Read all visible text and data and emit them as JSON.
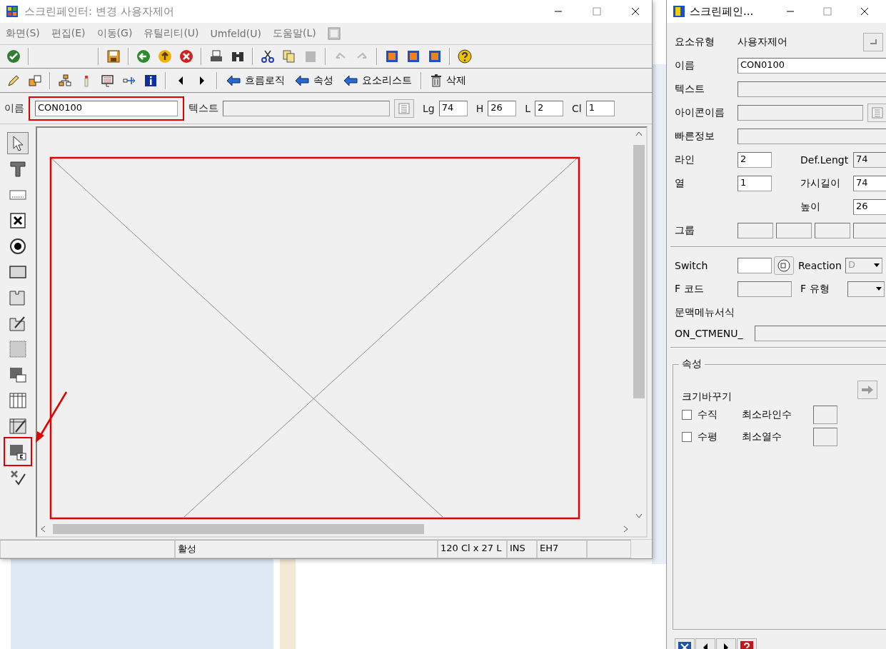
{
  "main_window": {
    "title": "스크린페인터:  변경 사용자제어"
  },
  "menu": [
    {
      "label": "화면(S)"
    },
    {
      "label": "편집(E)"
    },
    {
      "label": "이동(G)"
    },
    {
      "label": "유틸리티(U)"
    },
    {
      "label": "Umfeld(U)"
    },
    {
      "label": "도움말(L)"
    }
  ],
  "toolbar_1": [
    {
      "kind": "check",
      "disabled": false
    },
    {
      "kind": "separator"
    },
    {
      "kind": "spacer"
    },
    {
      "kind": "separator"
    },
    {
      "kind": "save",
      "disabled": false
    },
    {
      "kind": "separator"
    },
    {
      "kind": "back",
      "disabled": false
    },
    {
      "kind": "exit",
      "disabled": false
    },
    {
      "kind": "cancel",
      "disabled": false
    },
    {
      "kind": "separator"
    },
    {
      "kind": "print",
      "disabled": false
    },
    {
      "kind": "find",
      "disabled": false
    },
    {
      "kind": "separator"
    },
    {
      "kind": "cut",
      "disabled": false
    },
    {
      "kind": "copy",
      "disabled": false
    },
    {
      "kind": "paste",
      "disabled": true
    },
    {
      "kind": "separator"
    },
    {
      "kind": "undo",
      "disabled": true
    },
    {
      "kind": "redo",
      "disabled": true
    },
    {
      "kind": "separator"
    },
    {
      "kind": "layout",
      "disabled": false
    },
    {
      "kind": "layout",
      "disabled": false
    },
    {
      "kind": "layout",
      "disabled": false
    },
    {
      "kind": "separator"
    },
    {
      "kind": "help",
      "disabled": false
    }
  ],
  "toolbar_2": [
    {
      "kind": "pencil"
    },
    {
      "kind": "copy-screen"
    },
    {
      "kind": "separator"
    },
    {
      "kind": "hierarchy"
    },
    {
      "kind": "marker"
    },
    {
      "kind": "screen"
    },
    {
      "kind": "connector"
    },
    {
      "kind": "info"
    },
    {
      "kind": "separator"
    },
    {
      "kind": "prev"
    },
    {
      "kind": "next"
    },
    {
      "kind": "separator"
    },
    {
      "kind": "text-arrow",
      "label": "흐름로직"
    },
    {
      "kind": "text-arrow",
      "label": "속성"
    },
    {
      "kind": "text-arrow",
      "label": "요소리스트"
    },
    {
      "kind": "separator"
    },
    {
      "kind": "text-trash",
      "label": "삭제"
    }
  ],
  "attribute_bar": {
    "name": {
      "label": "이름",
      "value": "CON0100",
      "highlighted": true
    },
    "text": {
      "label": "텍스트"
    },
    "fields": [
      {
        "label": "Lg",
        "value": "74"
      },
      {
        "label": "H",
        "value": "26"
      },
      {
        "label": "L",
        "value": "2"
      },
      {
        "label": "Cl",
        "value": "1"
      }
    ]
  },
  "palette": [
    {
      "kind": "pointer",
      "selected": true,
      "highlighted": false
    },
    {
      "kind": "text",
      "selected": false,
      "highlighted": false
    },
    {
      "kind": "input",
      "selected": false,
      "highlighted": false
    },
    {
      "kind": "checkbox",
      "selected": false,
      "highlighted": false
    },
    {
      "kind": "radio",
      "selected": false,
      "highlighted": false
    },
    {
      "kind": "pushbutton",
      "selected": false,
      "highlighted": false
    },
    {
      "kind": "tabstrip",
      "selected": false,
      "highlighted": false
    },
    {
      "kind": "wizard",
      "selected": false,
      "highlighted": false
    },
    {
      "kind": "box",
      "selected": false,
      "highlighted": false
    },
    {
      "kind": "subscreen",
      "selected": false,
      "highlighted": false
    },
    {
      "kind": "table",
      "selected": false,
      "highlighted": false
    },
    {
      "kind": "table-wizard",
      "selected": false,
      "highlighted": false
    },
    {
      "kind": "custom",
      "selected": false,
      "highlighted": true
    },
    {
      "kind": "status",
      "selected": false,
      "highlighted": false
    }
  ],
  "canvas": {
    "element_highlighted": true,
    "arrow_shown": true
  },
  "status_bar": [
    {
      "text": "활성"
    },
    {
      "text": "120 Cl x 27 L"
    },
    {
      "text": "INS"
    },
    {
      "text": "EH7"
    }
  ],
  "attributes_window": {
    "title": "스크린페인...",
    "element_type": {
      "label": "요소유형",
      "value": "사용자제어"
    },
    "name": {
      "label": "이름",
      "value": "CON0100",
      "editable": true
    },
    "text": {
      "label": "텍스트",
      "editable": false
    },
    "icon_name": {
      "label": "아이콘이름",
      "editable": false
    },
    "quick_info": {
      "label": "빠른정보",
      "editable": false
    },
    "line": {
      "label": "라인",
      "value": "2",
      "editable": true
    },
    "column": {
      "label": "열",
      "value": "1",
      "editable": true
    },
    "def_length": {
      "label": "Def.Lengt",
      "value": "74",
      "editable": false
    },
    "visible_length": {
      "label": "가시길이",
      "value": "74",
      "editable": true
    },
    "height": {
      "label": "높이",
      "value": "26",
      "editable": true
    },
    "group": {
      "label": "그룹"
    },
    "switch": {
      "label": "Switch",
      "editable": true
    },
    "reaction": {
      "label": "Reaction",
      "value": "D"
    },
    "f_code": {
      "label": "F 코드",
      "editable": false
    },
    "f_type": {
      "label": "F 유형"
    },
    "context_menu": {
      "label": "문맥메뉴서식",
      "prefix": "ON_CTMENU_"
    },
    "attributes_group": {
      "title": "속성",
      "resize_label": "크기바꾸기",
      "options": [
        {
          "label": "수직",
          "checked": false,
          "min_label": "최소라인수"
        },
        {
          "label": "수평",
          "checked": false,
          "min_label": "최소열수"
        }
      ]
    }
  }
}
